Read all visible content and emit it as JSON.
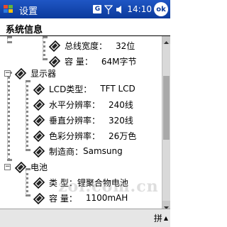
{
  "taskbar": {
    "app_title": "设置",
    "time": "14:10",
    "ok_label": "ok",
    "g_label": "G",
    "icons": [
      "start-icon",
      "signal-icon",
      "volume-icon"
    ]
  },
  "page": {
    "title": "系统信息"
  },
  "tree": {
    "memory": {
      "bus_width_label": "总线宽度：",
      "bus_width_value": "32位",
      "capacity_label": "容 量：",
      "capacity_value": "64M字节"
    },
    "display": {
      "label": "显示器",
      "toggle": "−",
      "lcd_type_label": "LCD类型：",
      "lcd_type_value": "TFT LCD",
      "h_res_label": "水平分辨率：",
      "h_res_value": "240线",
      "v_res_label": "垂直分辨率：",
      "v_res_value": "320线",
      "color_res_label": "色彩分辨率：",
      "color_res_value": "26万色",
      "maker_label": "制造商：",
      "maker_value": "Samsung"
    },
    "battery": {
      "label": "电池",
      "toggle": "−",
      "type_label": "类 型：",
      "type_value": "锂聚合物电池",
      "capacity_label": "容 量：",
      "capacity_value": "1100mAH"
    }
  },
  "bottombar": {
    "input_label": "拼"
  },
  "watermark": "zol.com.cn",
  "colors": {
    "taskbar": "#0b3a9c",
    "scrollbar": "#d9d9d9"
  }
}
